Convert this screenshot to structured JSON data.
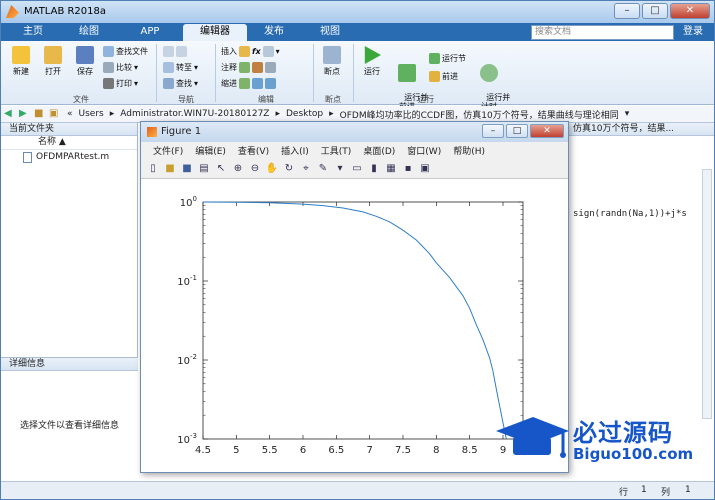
{
  "app": {
    "title": "MATLAB R2018a"
  },
  "tabs": [
    {
      "label": "主页"
    },
    {
      "label": "绘图"
    },
    {
      "label": "APP"
    },
    {
      "label": "编辑器"
    },
    {
      "label": "发布"
    },
    {
      "label": "视图"
    }
  ],
  "search": {
    "placeholder": "搜索文档",
    "login": "登录"
  },
  "ribbon": {
    "file": {
      "new": "新建",
      "open": "打开",
      "save": "保存",
      "find_files": "查找文件",
      "compare": "比较",
      "print": "打印",
      "group": "文件"
    },
    "navigate": {
      "goto": "转至",
      "find": "查找",
      "group": "导航"
    },
    "edit": {
      "insert": "插入",
      "fx": "fx",
      "comment": "注释",
      "indent": "缩进",
      "group": "编辑"
    },
    "breakpoints": {
      "breakpoints": "断点",
      "group": "断点"
    },
    "run": {
      "run": "运行",
      "run_advance": "运行并\n前进",
      "run_section": "运行节",
      "advance": "前进",
      "run_time": "运行并\n计时",
      "group": "运行"
    }
  },
  "address": {
    "parts": [
      "«",
      "Users",
      "Administrator.WIN7U-20180127Z",
      "Desktop",
      "OFDM峰均功率比的CCDF图，仿真10万个符号，结果曲线与理论相同"
    ]
  },
  "left_panel": {
    "header": "当前文件夹",
    "col_name": "名称 ▲",
    "files": [
      "OFDMPARtest.m"
    ],
    "detail_header": "详细信息",
    "detail_text": "选择文件以查看详细信息"
  },
  "right_panel": {
    "header": "仿真10万个符号，结果...",
    "code": "sign(randn(Na,1))+j*s"
  },
  "status": {
    "line_label": "行",
    "line_value": "1",
    "col_label": "列",
    "col_value": "1"
  },
  "figure": {
    "title": "Figure 1",
    "menu": [
      "文件(F)",
      "编辑(E)",
      "查看(V)",
      "插入(I)",
      "工具(T)",
      "桌面(D)",
      "窗口(W)",
      "帮助(H)"
    ]
  },
  "watermark": {
    "title": "必过源码",
    "url": "Biguo100.com"
  },
  "chart_data": {
    "type": "line",
    "yscale": "log",
    "xlim": [
      4.5,
      9.3
    ],
    "ylim": [
      0.001,
      1
    ],
    "xticks": [
      4.5,
      5,
      5.5,
      6,
      6.5,
      7,
      7.5,
      8,
      8.5,
      9
    ],
    "ytick_labels": [
      "10^0",
      "10^-1",
      "10^-2",
      "10^-3"
    ],
    "yticks": [
      1,
      0.1,
      0.01,
      0.001
    ],
    "color": "#2f7ec8",
    "x": [
      4.5,
      5.0,
      5.5,
      6.0,
      6.3,
      6.6,
      6.9,
      7.1,
      7.3,
      7.5,
      7.7,
      7.8,
      7.9,
      8.0,
      8.2,
      8.4,
      8.5,
      8.6,
      8.7,
      8.8,
      8.85,
      8.9,
      8.95,
      9.0,
      9.05
    ],
    "y": [
      1,
      0.995,
      0.98,
      0.94,
      0.9,
      0.84,
      0.75,
      0.66,
      0.56,
      0.44,
      0.33,
      0.27,
      0.22,
      0.17,
      0.11,
      0.065,
      0.045,
      0.028,
      0.018,
      0.0105,
      0.0072,
      0.0043,
      0.0026,
      0.0016,
      0.001
    ]
  }
}
